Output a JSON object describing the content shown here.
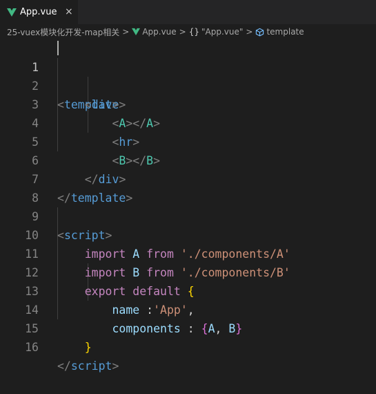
{
  "tab": {
    "filename": "App.vue",
    "close_glyph": "×",
    "icon": "vue-icon"
  },
  "breadcrumb": {
    "folder": "25-vuex模块化开发-map相关",
    "file": "App.vue",
    "object": "\"App.vue\"",
    "object_prefix": "{}",
    "symbol": "template",
    "separator": ">"
  },
  "editor": {
    "line_numbers": [
      "1",
      "2",
      "3",
      "4",
      "5",
      "6",
      "7",
      "8",
      "9",
      "10",
      "11",
      "12",
      "13",
      "14",
      "15",
      "16"
    ],
    "active_line": "1",
    "lines": {
      "l1": {
        "lt": "<",
        "tag": "template",
        "gt": ">"
      },
      "l2": {
        "lt": "<",
        "tag": "div",
        "gt": ">"
      },
      "l3": {
        "lt": "<",
        "tag": "A",
        "gt": ">",
        "lt2": "</",
        "tag2": "A",
        "gt2": ">"
      },
      "l4": {
        "lt": "<",
        "tag": "hr",
        "gt": ">"
      },
      "l5": {
        "lt": "<",
        "tag": "B",
        "gt": ">",
        "lt2": "</",
        "tag2": "B",
        "gt2": ">"
      },
      "l6": {
        "lt": "</",
        "tag": "div",
        "gt": ">"
      },
      "l7": {
        "lt": "</",
        "tag": "template",
        "gt": ">"
      },
      "l9": {
        "lt": "<",
        "tag": "script",
        "gt": ">"
      },
      "l10": {
        "kw": "import",
        "id": "A",
        "from": "from",
        "str": "'./components/A'"
      },
      "l11": {
        "kw": "import",
        "id": "B",
        "from": "from",
        "str": "'./components/B'"
      },
      "l12": {
        "kw": "export",
        "kw2": "default",
        "brace": "{"
      },
      "l13": {
        "prop": "name",
        "colon": " :",
        "str": "'App'",
        "comma": ","
      },
      "l14": {
        "prop": "components",
        "colon": " : ",
        "open": "{",
        "a": "A",
        "sep": ", ",
        "b": "B",
        "close": "}"
      },
      "l15": {
        "brace": "}"
      },
      "l16": {
        "lt": "</",
        "tag": "script",
        "gt": ">"
      }
    }
  },
  "colors": {
    "background": "#1e1e1e",
    "tag": "#569cd6",
    "component": "#4ec9b0",
    "keyword": "#c586c0",
    "string": "#ce9178",
    "identifier": "#9cdcfe",
    "vue_green": "#41b883"
  }
}
